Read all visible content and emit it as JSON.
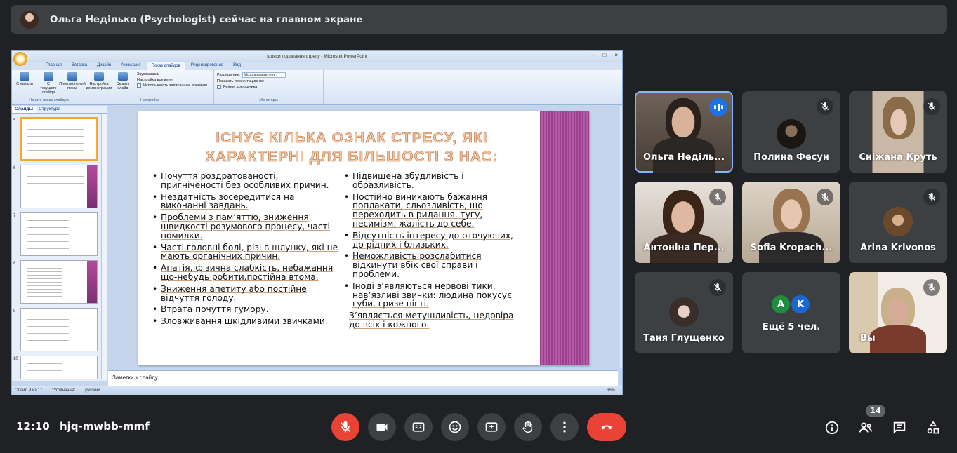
{
  "banner": {
    "text": "Ольга Неділько (Psychologist) сейчас на главном экране"
  },
  "ppt": {
    "window_title": "шляхи подолання стресу - Microsoft PowerPoint",
    "tabs": [
      "Главная",
      "Вставка",
      "Дизайн",
      "Анимация",
      "Показ слайдов",
      "Рецензирование",
      "Вид"
    ],
    "active_tab": "Показ слайдов",
    "ribbon": {
      "start_group": "Начать показ слайдов",
      "start_items": [
        "С начала",
        "С текущего слайда",
        "Произвольный показ"
      ],
      "setup_group": "Настройка",
      "setup_items": [
        "Настройка демонстрации",
        "Скрыть слайд"
      ],
      "setup_options": [
        "Звукозапись",
        "Настройка времени",
        "Использовать записанные времени"
      ],
      "monitors_group": "Мониторы",
      "resolution_label": "Разрешение:",
      "resolution_value": "Использовать теку...",
      "show_on_label": "Показать презентацию на:",
      "presenter_label": "Режим докладчика"
    },
    "pane_tabs": [
      "Слайды",
      "Структура"
    ],
    "thumb_numbers": [
      "5",
      "6",
      "7",
      "8",
      "9",
      "10"
    ],
    "slide": {
      "title_line1": "ІСНУЄ КІЛЬКА ОЗНАК СТРЕСУ, ЯКІ",
      "title_line2": "ХАРАКТЕРНІ ДЛЯ БІЛЬШОСТІ З НАС:",
      "left_items": [
        "Почуття роздратованості, пригніченості без особливих причин.",
        "Нездатність зосередитися на виконанні завдань.",
        "Проблеми з пам’яттю, зниження швидкості розумового процесу, часті помилки.",
        "Часті головні болі, різі в шлунку, які не мають органічних причин.",
        "Апатія, фізична слабкість, небажання що-небудь робити,постійна втома.",
        "Зниження апетиту або постійне відчуття голоду.",
        "Втрата почуття гумору.",
        "Зловживання шкідливими звичками."
      ],
      "right_items": [
        "Підвищена збудливість і образливість.",
        "Постійно виникають бажання поплакати, сльозливість, що переходить в ридання, тугу, песимізм, жалість до себе.",
        "Відсутність інтересу до оточуючих, до рідних і близьких.",
        "Неможливість розслабитися відкинути вбік свої справи і проблеми.",
        "Іноді з’являються нервові тики, нав’язливі звички: людина покусує губи, гризе нігті."
      ],
      "right_tail": "З’являється метушливість, недовіра до всіх і кожного."
    },
    "notes_placeholder": "Заметки к слайду",
    "status": {
      "slide": "Слайд 9 из 17",
      "theme": "\"Угоднання\"",
      "lang": "русский",
      "zoom": "66%"
    }
  },
  "participants": [
    {
      "name": "Ольга Неділь...",
      "speaking": true
    },
    {
      "name": "Полина Фесун",
      "muted": true
    },
    {
      "name": "Сніжана Круть",
      "muted": true
    },
    {
      "name": "Антоніна Пер...",
      "muted": true
    },
    {
      "name": "Sofia Kropach...",
      "muted": true
    },
    {
      "name": "Arina Krivonos",
      "muted": true
    },
    {
      "name": "Таня Глущенко",
      "muted": true
    },
    {
      "name": "Ещё 5 чел.",
      "initials": [
        "A",
        "K"
      ]
    },
    {
      "name": "Вы",
      "muted": true
    }
  ],
  "colors": {
    "accent": "#8ab4f8",
    "danger": "#ea4335",
    "tile": "#3c4043",
    "avatar_a": "#1e8e3e",
    "avatar_k": "#1967d2"
  },
  "bottom": {
    "time": "12:10",
    "meeting_code": "hjq-mwbb-mmf",
    "participants_count": "14"
  },
  "controls": [
    "mic-off-icon",
    "camera-icon",
    "captions-icon",
    "emoji-icon",
    "present-icon",
    "hand-icon",
    "more-icon",
    "hangup-icon"
  ]
}
